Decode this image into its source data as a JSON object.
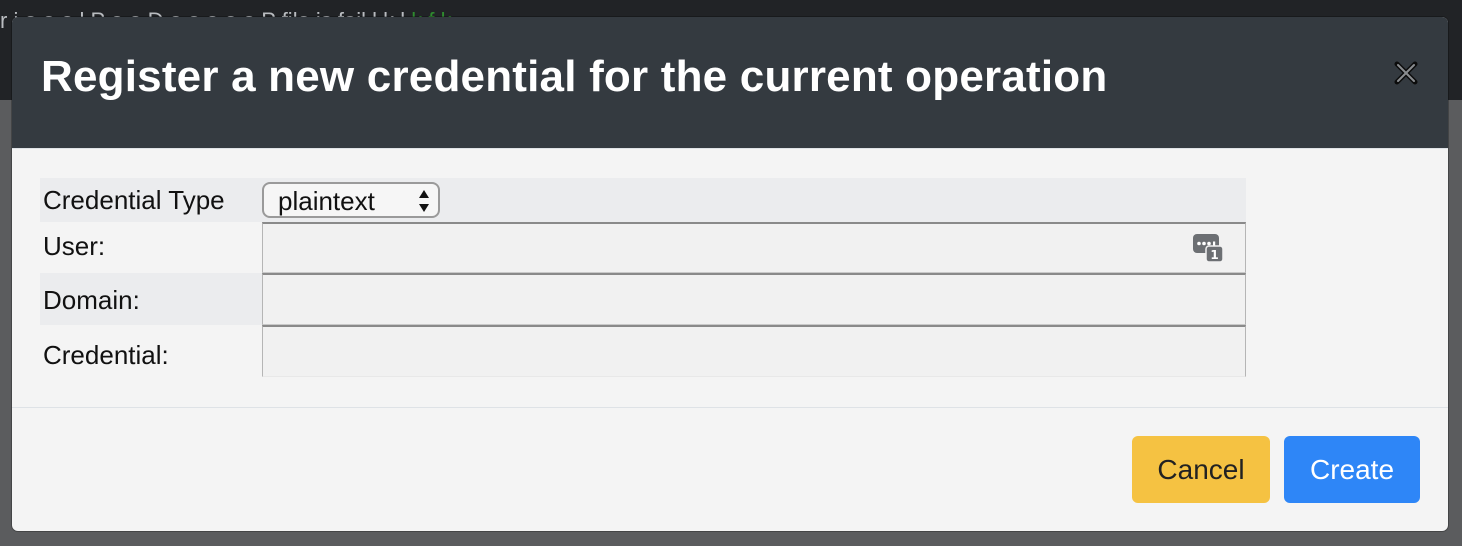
{
  "background": {
    "partial_text": "r i e e e l P e e D e e e e e P file is fail l k l",
    "partial_text_green": "k f k"
  },
  "modal": {
    "title": "Register a new credential for the current operation",
    "close_icon": "close-icon",
    "form": {
      "credential_type": {
        "label": "Credential Type",
        "selected": "plaintext"
      },
      "user": {
        "label": "User:",
        "value": "",
        "autofill_icon": "password-autofill-icon"
      },
      "domain": {
        "label": "Domain:",
        "value": ""
      },
      "credential": {
        "label": "Credential:",
        "value": ""
      }
    },
    "footer": {
      "cancel_label": "Cancel",
      "create_label": "Create"
    }
  },
  "colors": {
    "header_bg": "#343a40",
    "cancel_bg": "#f5c242",
    "create_bg": "#2e86f7"
  }
}
